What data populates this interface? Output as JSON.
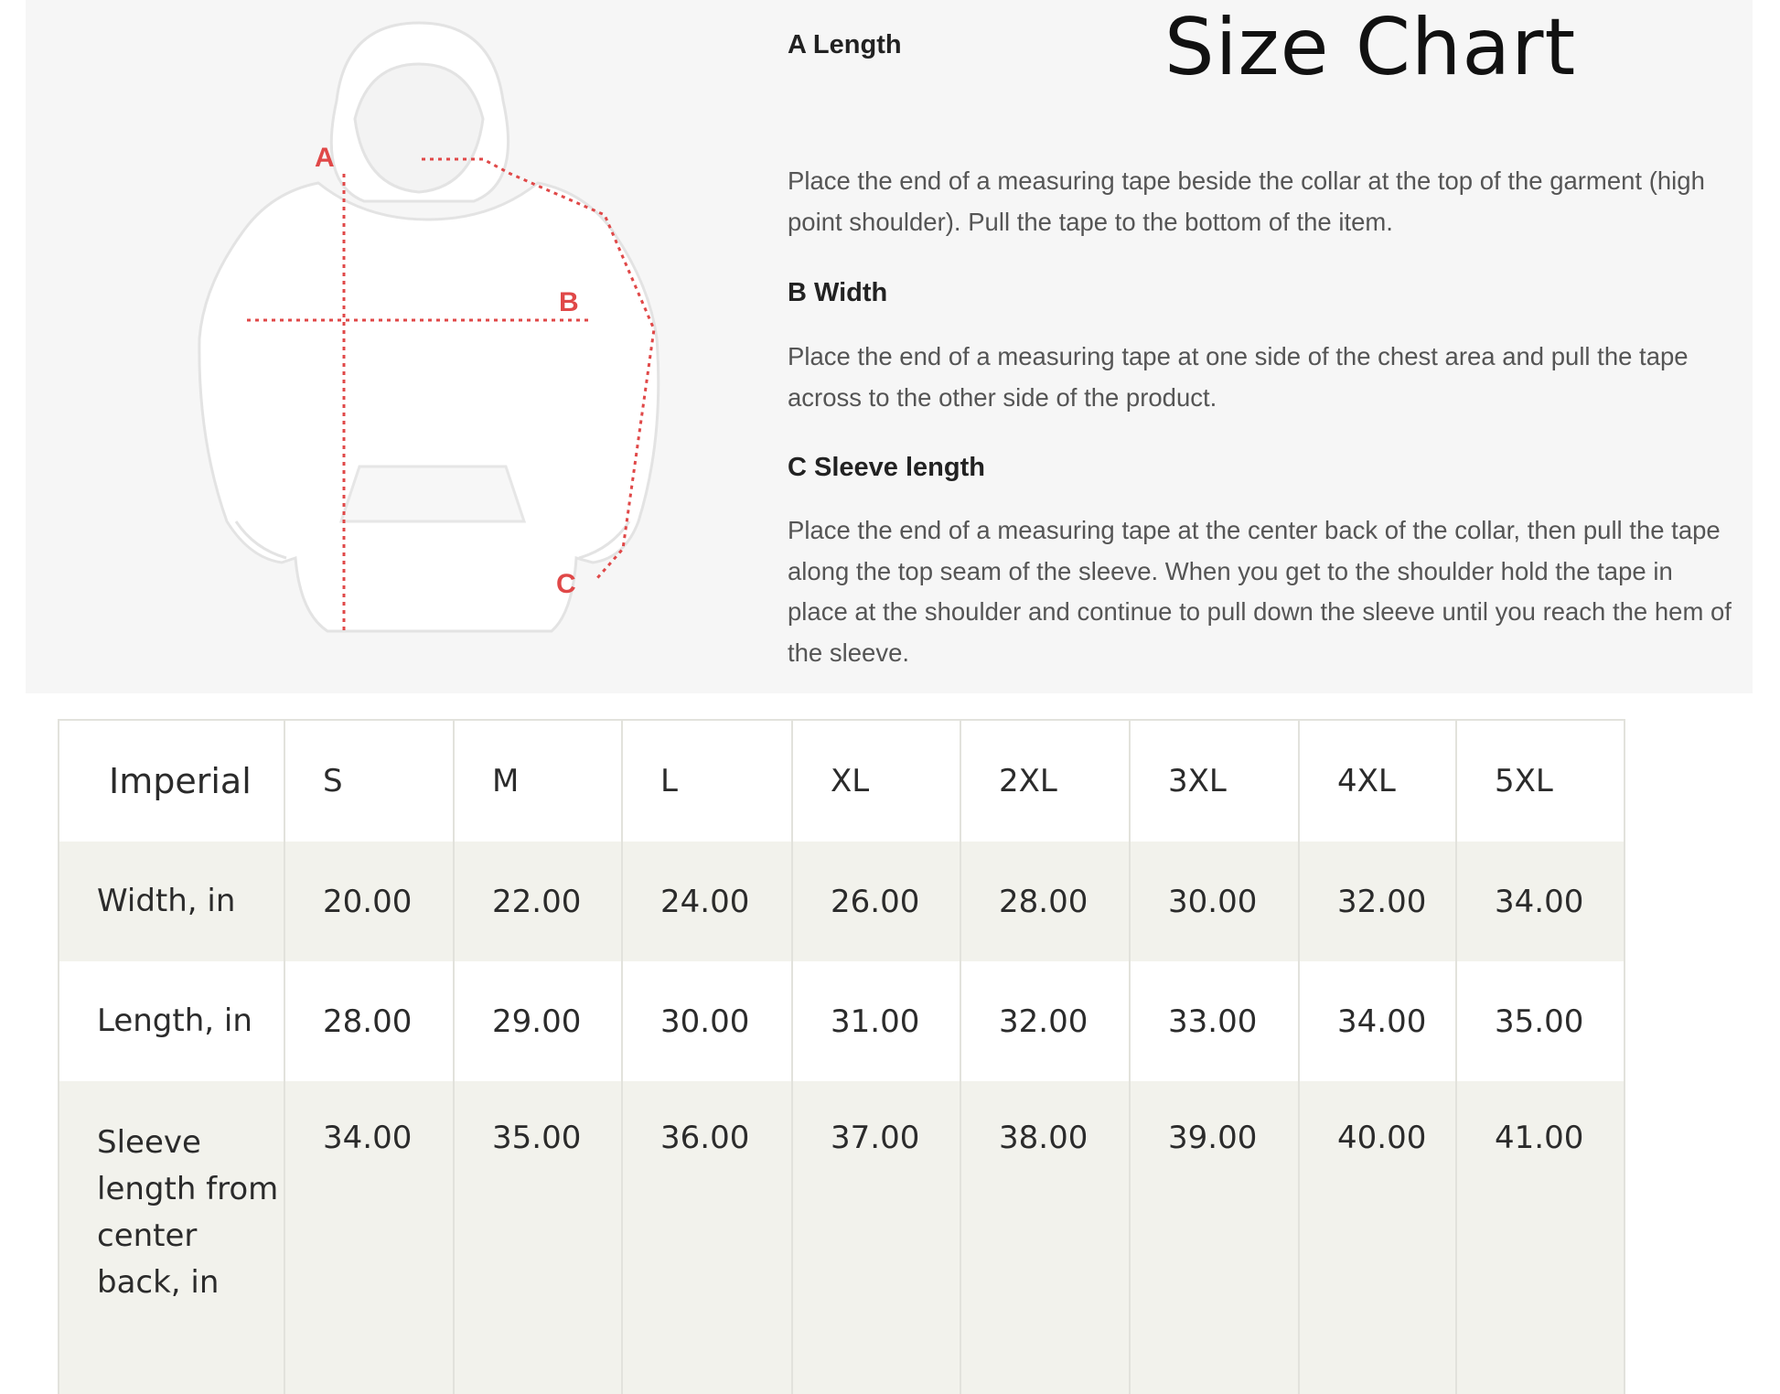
{
  "title": "Size Chart",
  "diagram": {
    "labels": [
      "A",
      "B",
      "C"
    ],
    "measure_color": "#e04848"
  },
  "instructions": [
    {
      "heading": "A Length",
      "text": "Place the end of a measuring tape beside the collar at the top of the garment (high point shoulder). Pull the tape to the bottom of the item."
    },
    {
      "heading": "B Width",
      "text": "Place the end of a measuring tape at one side of the chest area and pull the tape across to the other side of the product."
    },
    {
      "heading": "C Sleeve length",
      "text": "Place the end of a measuring tape at the center back of the collar, then pull the tape along the top seam of the sleeve. When you get to the shoulder hold the tape in place at the shoulder and continue to pull down the sleeve until you reach the hem of the sleeve."
    }
  ],
  "table": {
    "header": "Imperial",
    "sizes": [
      "S",
      "M",
      "L",
      "XL",
      "2XL",
      "3XL",
      "4XL",
      "5XL"
    ],
    "rows": [
      {
        "label": "Width, in",
        "values": [
          "20.00",
          "22.00",
          "24.00",
          "26.00",
          "28.00",
          "30.00",
          "32.00",
          "34.00"
        ]
      },
      {
        "label": "Length, in",
        "values": [
          "28.00",
          "29.00",
          "30.00",
          "31.00",
          "32.00",
          "33.00",
          "34.00",
          "35.00"
        ]
      },
      {
        "label": "Sleeve length from center back, in",
        "values": [
          "34.00",
          "35.00",
          "36.00",
          "37.00",
          "38.00",
          "39.00",
          "40.00",
          "41.00"
        ]
      }
    ]
  }
}
